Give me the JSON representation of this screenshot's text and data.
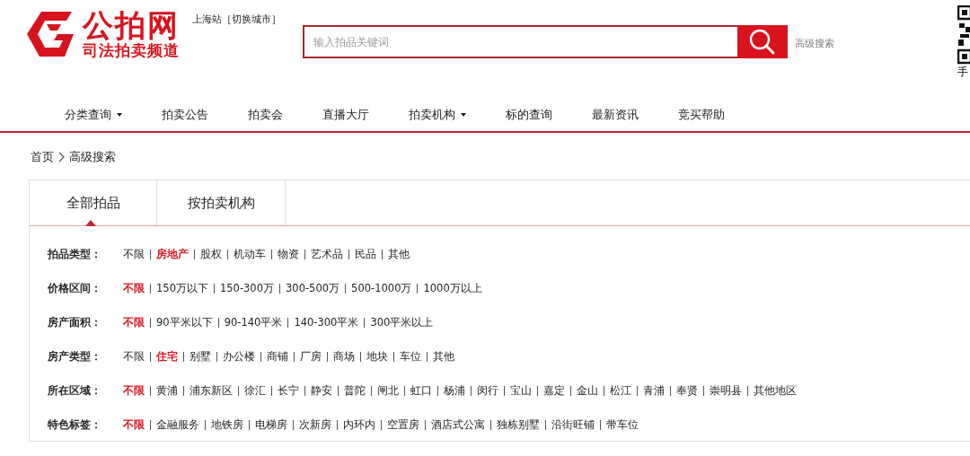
{
  "logo": {
    "title": "公拍网",
    "subtitle": "司法拍卖频道"
  },
  "city": "上海站［切换城市］",
  "search": {
    "placeholder": "输入拍品关键词"
  },
  "advanced_search": "高级搜索",
  "qr_caption": "手",
  "nav": [
    {
      "label": "分类查询",
      "dropdown": true
    },
    {
      "label": "拍卖公告",
      "dropdown": false
    },
    {
      "label": "拍卖会",
      "dropdown": false
    },
    {
      "label": "直播大厅",
      "dropdown": false
    },
    {
      "label": "拍卖机构",
      "dropdown": true
    },
    {
      "label": "标的查询",
      "dropdown": false
    },
    {
      "label": "最新资讯",
      "dropdown": false
    },
    {
      "label": "竞买帮助",
      "dropdown": false
    }
  ],
  "breadcrumb": [
    "首页",
    "高级搜索"
  ],
  "tabs": [
    {
      "label": "全部拍品",
      "selected": true
    },
    {
      "label": "按拍卖机构",
      "selected": false
    }
  ],
  "filters": [
    {
      "label": "拍品类型：",
      "options": [
        {
          "text": "不限",
          "selected": false
        },
        {
          "text": "房地产",
          "selected": true
        },
        {
          "text": "股权",
          "selected": false
        },
        {
          "text": "机动车",
          "selected": false
        },
        {
          "text": "物资",
          "selected": false
        },
        {
          "text": "艺术品",
          "selected": false
        },
        {
          "text": "民品",
          "selected": false
        },
        {
          "text": "其他",
          "selected": false
        }
      ]
    },
    {
      "label": "价格区间：",
      "options": [
        {
          "text": "不限",
          "selected": true
        },
        {
          "text": "150万以下",
          "selected": false
        },
        {
          "text": "150-300万",
          "selected": false
        },
        {
          "text": "300-500万",
          "selected": false
        },
        {
          "text": "500-1000万",
          "selected": false
        },
        {
          "text": "1000万以上",
          "selected": false
        }
      ]
    },
    {
      "label": "房产面积：",
      "options": [
        {
          "text": "不限",
          "selected": true
        },
        {
          "text": "90平米以下",
          "selected": false
        },
        {
          "text": "90-140平米",
          "selected": false
        },
        {
          "text": "140-300平米",
          "selected": false
        },
        {
          "text": "300平米以上",
          "selected": false
        }
      ]
    },
    {
      "label": "房产类型：",
      "options": [
        {
          "text": "不限",
          "selected": false
        },
        {
          "text": "住宅",
          "selected": true
        },
        {
          "text": "别墅",
          "selected": false
        },
        {
          "text": "办公楼",
          "selected": false
        },
        {
          "text": "商铺",
          "selected": false
        },
        {
          "text": "厂房",
          "selected": false
        },
        {
          "text": "商场",
          "selected": false
        },
        {
          "text": "地块",
          "selected": false
        },
        {
          "text": "车位",
          "selected": false
        },
        {
          "text": "其他",
          "selected": false
        }
      ]
    },
    {
      "label": "所在区域：",
      "options": [
        {
          "text": "不限",
          "selected": true
        },
        {
          "text": "黄浦",
          "selected": false
        },
        {
          "text": "浦东新区",
          "selected": false
        },
        {
          "text": "徐汇",
          "selected": false
        },
        {
          "text": "长宁",
          "selected": false
        },
        {
          "text": "静安",
          "selected": false
        },
        {
          "text": "普陀",
          "selected": false
        },
        {
          "text": "闸北",
          "selected": false
        },
        {
          "text": "虹口",
          "selected": false
        },
        {
          "text": "杨浦",
          "selected": false
        },
        {
          "text": "闵行",
          "selected": false
        },
        {
          "text": "宝山",
          "selected": false
        },
        {
          "text": "嘉定",
          "selected": false
        },
        {
          "text": "金山",
          "selected": false
        },
        {
          "text": "松江",
          "selected": false
        },
        {
          "text": "青浦",
          "selected": false
        },
        {
          "text": "奉贤",
          "selected": false
        },
        {
          "text": "崇明县",
          "selected": false
        },
        {
          "text": "其他地区",
          "selected": false
        }
      ]
    },
    {
      "label": "特色标签：",
      "options": [
        {
          "text": "不限",
          "selected": true
        },
        {
          "text": "金融服务",
          "selected": false
        },
        {
          "text": "地铁房",
          "selected": false
        },
        {
          "text": "电梯房",
          "selected": false
        },
        {
          "text": "次新房",
          "selected": false
        },
        {
          "text": "内环内",
          "selected": false
        },
        {
          "text": "空置房",
          "selected": false
        },
        {
          "text": "酒店式公寓",
          "selected": false
        },
        {
          "text": "独栋别墅",
          "selected": false
        },
        {
          "text": "沿街旺铺",
          "selected": false
        },
        {
          "text": "带车位",
          "selected": false
        }
      ]
    }
  ]
}
